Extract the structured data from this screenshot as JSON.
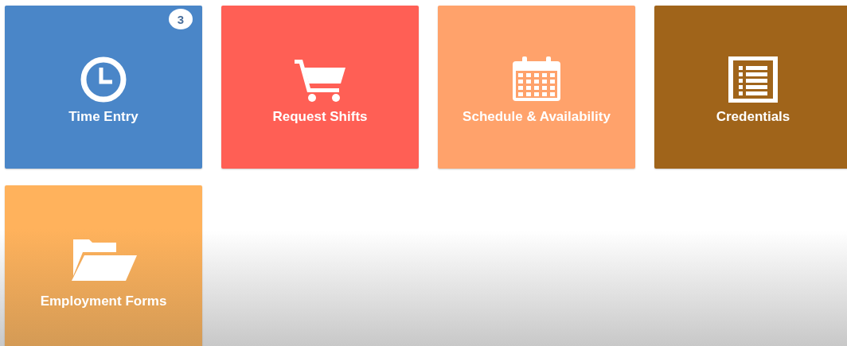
{
  "tiles": [
    {
      "label": "Time Entry",
      "color": "#4a86c8",
      "badge": "3"
    },
    {
      "label": "Request Shifts",
      "color": "#ff5f55"
    },
    {
      "label": "Schedule & Availability",
      "color": "#ffa26b"
    },
    {
      "label": "Credentials",
      "color": "#a0641a"
    },
    {
      "label": "Employment Forms",
      "color": "#ffb25c"
    }
  ]
}
